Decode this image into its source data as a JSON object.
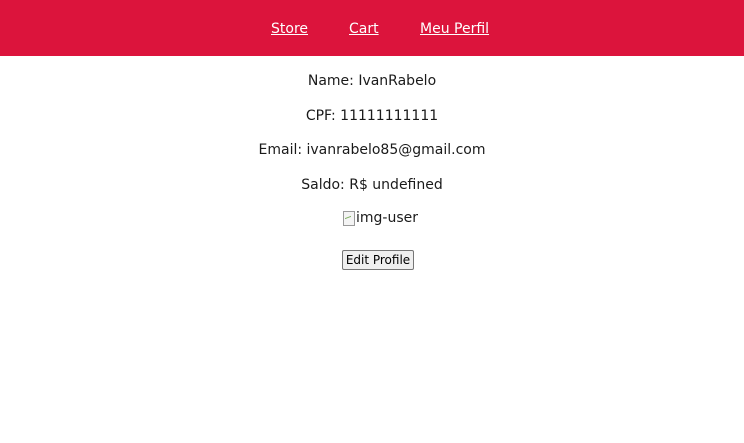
{
  "nav": {
    "store": "Store",
    "cart": "Cart",
    "perfil": "Meu Perfil"
  },
  "profile": {
    "name": "Name: IvanRabelo",
    "cpf": "CPF: 11111111111",
    "email": "Email: ivanrabelo85@gmail.com",
    "saldo": "Saldo: R$ undefined",
    "image_alt": "img-user",
    "image_icon": "broken-image-icon",
    "edit_button": "Edit Profile"
  },
  "colors": {
    "navbar_bg": "#dc143c",
    "nav_text": "#ffffff"
  }
}
